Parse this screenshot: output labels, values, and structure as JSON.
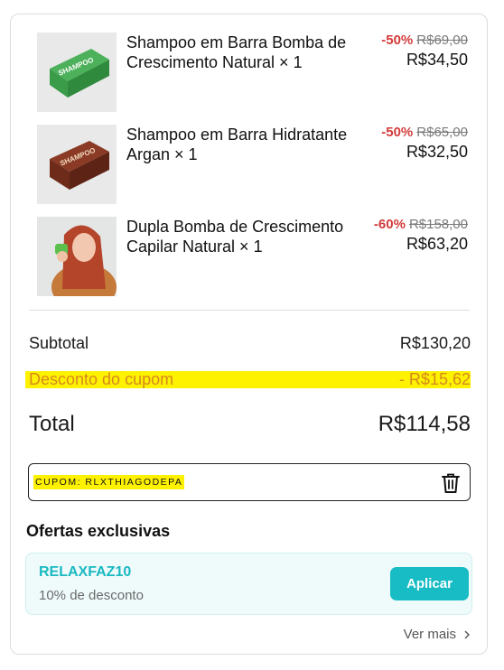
{
  "items": [
    {
      "name": "Shampoo em Barra Bomba de Crescimento Natural × 1",
      "discount": "-50%",
      "old_price": "R$69,00",
      "price": "R$34,50",
      "image": "green-shampoo-box"
    },
    {
      "name": "Shampoo em Barra Hidratante Argan × 1",
      "discount": "-50%",
      "old_price": "R$65,00",
      "price": "R$32,50",
      "image": "brown-shampoo-box"
    },
    {
      "name": "Dupla Bomba de Crescimento Capilar Natural × 1",
      "discount": "-60%",
      "old_price": "R$158,00",
      "price": "R$63,20",
      "image": "woman-holding-product"
    }
  ],
  "summary": {
    "subtotal_label": "Subtotal",
    "subtotal_value": "R$130,20",
    "coupon_label": "Desconto do cupom",
    "coupon_value": "- R$15,62",
    "total_label": "Total",
    "total_value": "R$114,58"
  },
  "coupon": {
    "code": "CUPOM: RLXTHIAGODEPA",
    "remove_icon": "trash-icon"
  },
  "offers": {
    "title": "Ofertas exclusivas",
    "code": "RELAXFAZ10",
    "description": "10% de desconto",
    "apply_label": "Aplicar",
    "see_more": "Ver mais"
  },
  "colors": {
    "discount_red": "#d33a3a",
    "highlight_yellow": "#fff200",
    "accent_teal": "#17bcc4"
  }
}
